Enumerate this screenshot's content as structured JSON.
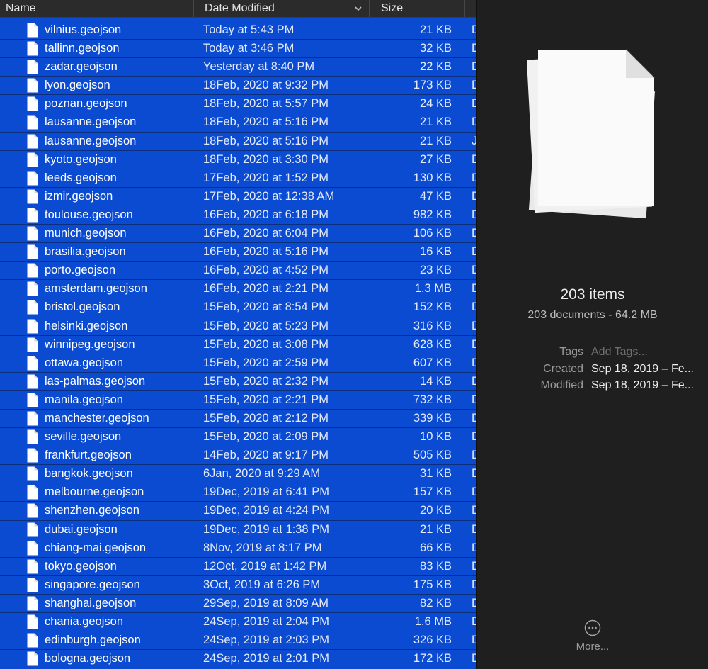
{
  "header": {
    "name_label": "Name",
    "date_label": "Date Modified",
    "size_label": "Size"
  },
  "files": [
    {
      "name": "vilnius.geojson",
      "date": "Today at 5:43 PM",
      "size": "21 KB",
      "kind": "D"
    },
    {
      "name": "tallinn.geojson",
      "date": "Today at 3:46 PM",
      "size": "32 KB",
      "kind": "D"
    },
    {
      "name": "zadar.geojson",
      "date": "Yesterday at 8:40 PM",
      "size": "22 KB",
      "kind": "D"
    },
    {
      "name": "lyon.geojson",
      "date": "18Feb, 2020 at 9:32 PM",
      "size": "173 KB",
      "kind": "D"
    },
    {
      "name": "poznan.geojson",
      "date": "18Feb, 2020 at 5:57 PM",
      "size": "24 KB",
      "kind": "D"
    },
    {
      "name": "lausanne.geojson",
      "date": "18Feb, 2020 at 5:16 PM",
      "size": "21 KB",
      "kind": "D"
    },
    {
      "name": "lausanne.geojson",
      "date": "18Feb, 2020 at 5:16 PM",
      "size": "21 KB",
      "kind": "J"
    },
    {
      "name": "kyoto.geojson",
      "date": "18Feb, 2020 at 3:30 PM",
      "size": "27 KB",
      "kind": "D"
    },
    {
      "name": "leeds.geojson",
      "date": "17Feb, 2020 at 1:52 PM",
      "size": "130 KB",
      "kind": "D"
    },
    {
      "name": "izmir.geojson",
      "date": "17Feb, 2020 at 12:38 AM",
      "size": "47 KB",
      "kind": "D"
    },
    {
      "name": "toulouse.geojson",
      "date": "16Feb, 2020 at 6:18 PM",
      "size": "982 KB",
      "kind": "D"
    },
    {
      "name": "munich.geojson",
      "date": "16Feb, 2020 at 6:04 PM",
      "size": "106 KB",
      "kind": "D"
    },
    {
      "name": "brasilia.geojson",
      "date": "16Feb, 2020 at 5:16 PM",
      "size": "16 KB",
      "kind": "D"
    },
    {
      "name": "porto.geojson",
      "date": "16Feb, 2020 at 4:52 PM",
      "size": "23 KB",
      "kind": "D"
    },
    {
      "name": "amsterdam.geojson",
      "date": "16Feb, 2020 at 2:21 PM",
      "size": "1.3 MB",
      "kind": "D"
    },
    {
      "name": "bristol.geojson",
      "date": "15Feb, 2020 at 8:54 PM",
      "size": "152 KB",
      "kind": "D"
    },
    {
      "name": "helsinki.geojson",
      "date": "15Feb, 2020 at 5:23 PM",
      "size": "316 KB",
      "kind": "D"
    },
    {
      "name": "winnipeg.geojson",
      "date": "15Feb, 2020 at 3:08 PM",
      "size": "628 KB",
      "kind": "D"
    },
    {
      "name": "ottawa.geojson",
      "date": "15Feb, 2020 at 2:59 PM",
      "size": "607 KB",
      "kind": "D"
    },
    {
      "name": "las-palmas.geojson",
      "date": "15Feb, 2020 at 2:32 PM",
      "size": "14 KB",
      "kind": "D"
    },
    {
      "name": "manila.geojson",
      "date": "15Feb, 2020 at 2:21 PM",
      "size": "732 KB",
      "kind": "D"
    },
    {
      "name": "manchester.geojson",
      "date": "15Feb, 2020 at 2:12 PM",
      "size": "339 KB",
      "kind": "D"
    },
    {
      "name": "seville.geojson",
      "date": "15Feb, 2020 at 2:09 PM",
      "size": "10 KB",
      "kind": "D"
    },
    {
      "name": "frankfurt.geojson",
      "date": "14Feb, 2020 at 9:17 PM",
      "size": "505 KB",
      "kind": "D"
    },
    {
      "name": "bangkok.geojson",
      "date": "6Jan, 2020 at 9:29 AM",
      "size": "31 KB",
      "kind": "D"
    },
    {
      "name": "melbourne.geojson",
      "date": "19Dec, 2019 at 6:41 PM",
      "size": "157 KB",
      "kind": "D"
    },
    {
      "name": "shenzhen.geojson",
      "date": "19Dec, 2019 at 4:24 PM",
      "size": "20 KB",
      "kind": "D"
    },
    {
      "name": "dubai.geojson",
      "date": "19Dec, 2019 at 1:38 PM",
      "size": "21 KB",
      "kind": "D"
    },
    {
      "name": "chiang-mai.geojson",
      "date": "8Nov, 2019 at 8:17 PM",
      "size": "66 KB",
      "kind": "D"
    },
    {
      "name": "tokyo.geojson",
      "date": "12Oct, 2019 at 1:42 PM",
      "size": "83 KB",
      "kind": "D"
    },
    {
      "name": "singapore.geojson",
      "date": "3Oct, 2019 at 6:26 PM",
      "size": "175 KB",
      "kind": "D"
    },
    {
      "name": "shanghai.geojson",
      "date": "29Sep, 2019 at 8:09 AM",
      "size": "82 KB",
      "kind": "D"
    },
    {
      "name": "chania.geojson",
      "date": "24Sep, 2019 at 2:04 PM",
      "size": "1.6 MB",
      "kind": "D"
    },
    {
      "name": "edinburgh.geojson",
      "date": "24Sep, 2019 at 2:03 PM",
      "size": "326 KB",
      "kind": "D"
    },
    {
      "name": "bologna.geojson",
      "date": "24Sep, 2019 at 2:01 PM",
      "size": "172 KB",
      "kind": "D"
    }
  ],
  "preview": {
    "items_count": "203 items",
    "summary": "203 documents - 64.2 MB",
    "tags_label": "Tags",
    "tags_placeholder": "Add Tags...",
    "created_label": "Created",
    "created_value": "Sep 18, 2019 – Fe...",
    "modified_label": "Modified",
    "modified_value": "Sep 18, 2019 – Fe...",
    "more_label": "More..."
  },
  "colors": {
    "selection": "#0a4bd2",
    "header_bg": "#2b2b2b",
    "preview_bg": "#1f1f1f"
  },
  "icons": {
    "file": "document-icon",
    "sort": "chevron-down-icon",
    "preview": "document-stack-icon",
    "more": "ellipsis-circle-icon"
  }
}
